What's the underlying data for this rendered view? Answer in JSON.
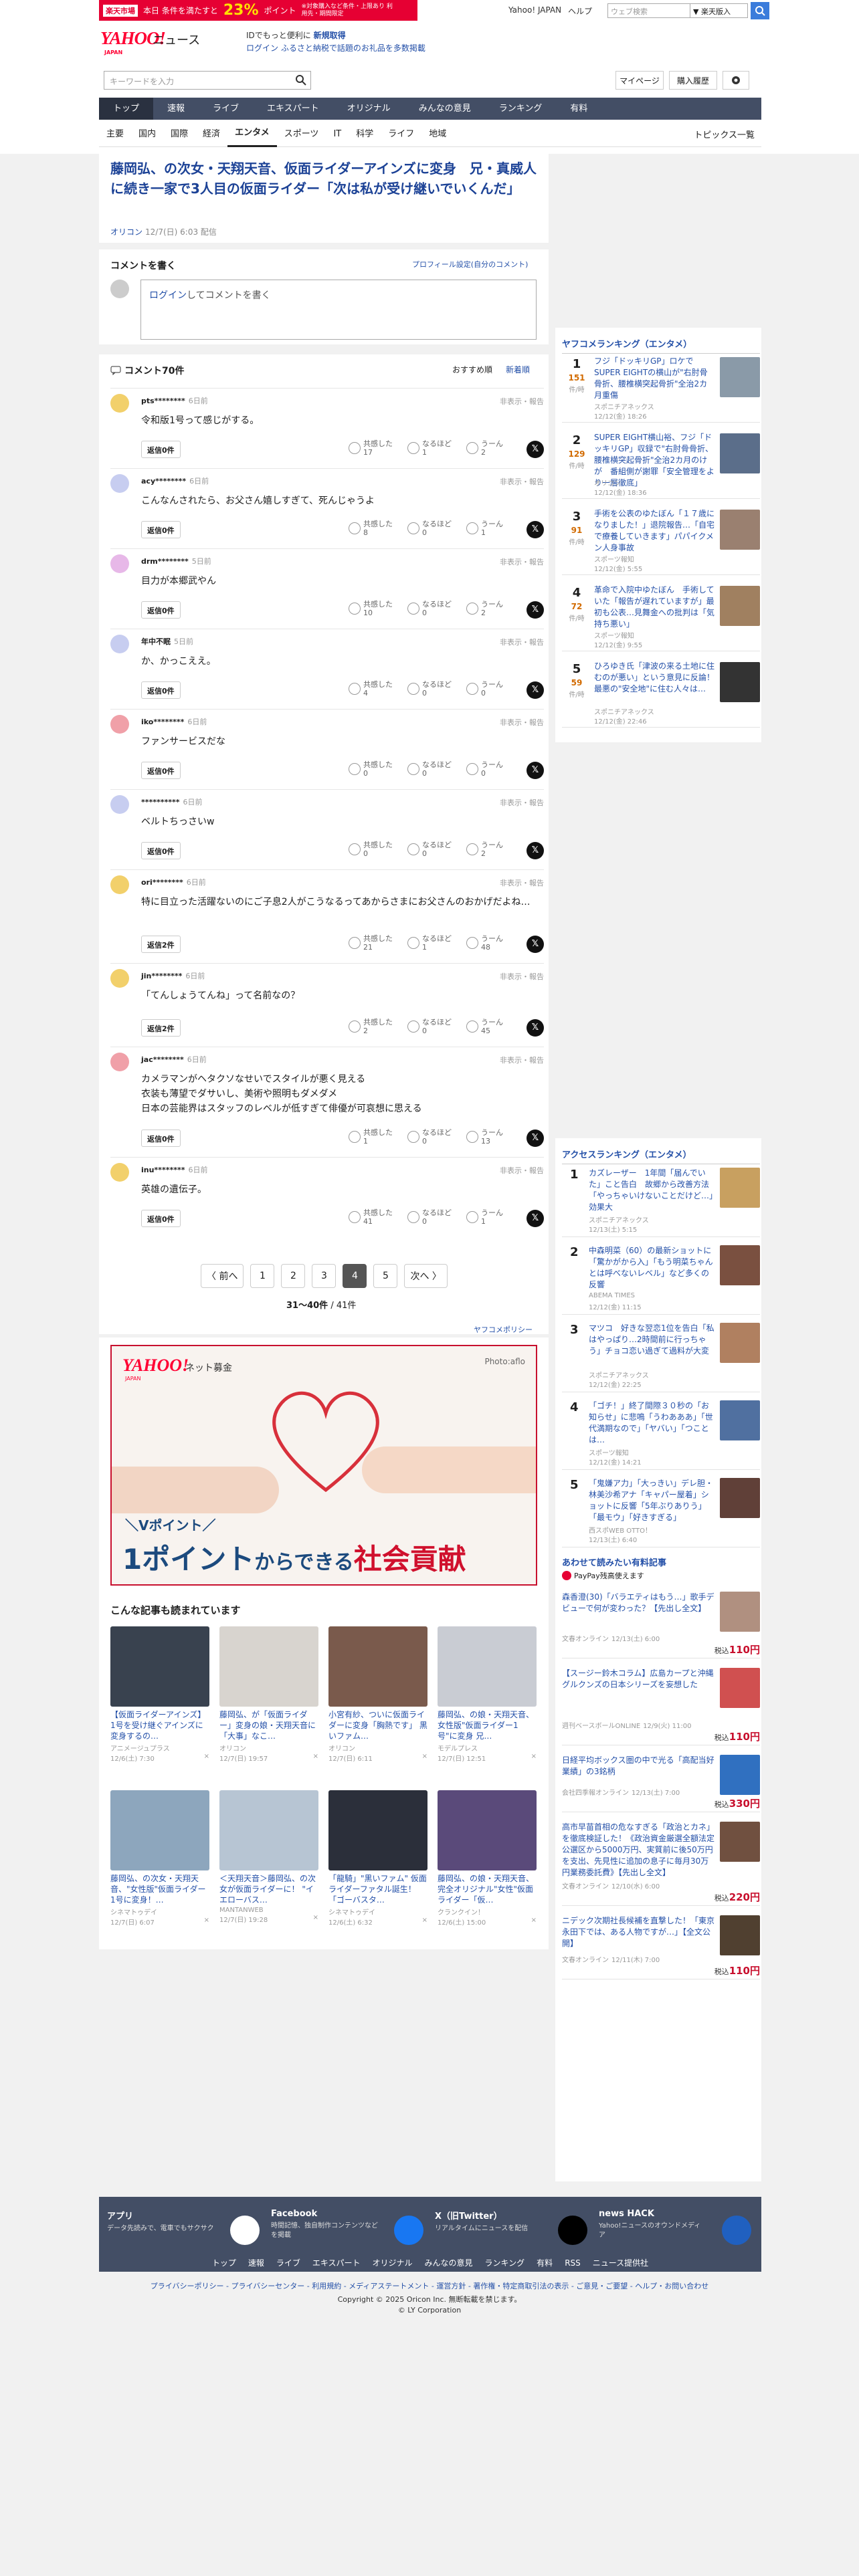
{
  "promo": {
    "brand": "楽天市場",
    "text": "本日 条件を満たすと",
    "pct": "23%",
    "suffix": "ポイント",
    "note": "※対象購入など条件・上限あり 利用先・期間限定"
  },
  "toplinks": [
    "Yahoo! JAPAN",
    "ヘルプ"
  ],
  "search_top": {
    "placeholder": "ウェブ検索",
    "button": "▼ 楽天版入"
  },
  "logo": {
    "main": "YAHOO!",
    "sub": "JAPAN",
    "word": "ニュース"
  },
  "header_promo": {
    "line1_pre": "IDでもっと便利に",
    "line1_link": "新規取得",
    "line2_link": "ログイン",
    "line2": "ふるさと納税で話題のお礼品を多数掲載"
  },
  "search": {
    "placeholder": "キーワードを入力",
    "mypage": "マイページ",
    "purchase": "購入履歴"
  },
  "nav": {
    "items": [
      "トップ",
      "速報",
      "ライブ",
      "エキスパート",
      "オリジナル",
      "みんなの意見",
      "ランキング",
      "有料"
    ],
    "active": 0
  },
  "subnav": {
    "items": [
      "主要",
      "国内",
      "国際",
      "経済",
      "エンタメ",
      "スポーツ",
      "IT",
      "科学",
      "ライフ",
      "地域"
    ],
    "active": 4,
    "right": "トピックス一覧"
  },
  "article": {
    "title": "藤岡弘、の次女・天翔天音、仮面ライダーアインズに変身　兄・真威人に続き一家で3人目の仮面ライダー「次は私が受け継いでいくんだ」",
    "source": "オリコン",
    "date": "12/7(日) 6:03 配信"
  },
  "comment_form": {
    "heading": "コメントを書く",
    "profile_link": "プロフィール設定(自分のコメント)",
    "login": "ログイン",
    "placeholder_rest": "してコメントを書く"
  },
  "comments_header": {
    "count": "コメント70件",
    "sort_recommend": "おすすめ順",
    "sort_new": "新着順"
  },
  "comment_labels": {
    "report": "非表示・報告",
    "agree": "共感した",
    "nice": "なるほど",
    "hmm": "うーん"
  },
  "comments": [
    {
      "name": "pts********",
      "time": "6日前",
      "text": "令和版1号って感じがする。",
      "reply": "返信0件",
      "agree": "17",
      "nice": "1",
      "hmm": "2",
      "avatar": "#f2d06b"
    },
    {
      "name": "acy********",
      "time": "6日前",
      "text": "こんなんされたら、お父さん嬉しすぎて、死んじゃうよ",
      "reply": "返信0件",
      "agree": "8",
      "nice": "0",
      "hmm": "1",
      "avatar": "#c7cdf0"
    },
    {
      "name": "drm********",
      "time": "5日前",
      "text": "目力が本郷武やん",
      "reply": "返信0件",
      "agree": "10",
      "nice": "0",
      "hmm": "2",
      "avatar": "#e7b8e8"
    },
    {
      "name": "年中不眠",
      "time": "5日前",
      "text": "か、かっこええ。",
      "reply": "返信0件",
      "agree": "4",
      "nice": "0",
      "hmm": "0",
      "avatar": "#c7cdf0"
    },
    {
      "name": "iko********",
      "time": "6日前",
      "text": "ファンサービスだな",
      "reply": "返信0件",
      "agree": "0",
      "nice": "0",
      "hmm": "0",
      "avatar": "#f0a0a8"
    },
    {
      "name": "**********",
      "time": "6日前",
      "text": "ベルトちっさいw",
      "reply": "返信0件",
      "agree": "0",
      "nice": "0",
      "hmm": "2",
      "avatar": "#c7cdf0"
    },
    {
      "name": "ori********",
      "time": "6日前",
      "text": "特に目立った活躍ないのにご子息2人がこうなるってあからさまにお父さんのおかげだよね…",
      "reply": "返信2件",
      "agree": "21",
      "nice": "1",
      "hmm": "48",
      "avatar": "#f2d06b"
    },
    {
      "name": "jin********",
      "time": "6日前",
      "text": "「てんしょうてんね」って名前なの？",
      "reply": "返信2件",
      "agree": "2",
      "nice": "0",
      "hmm": "45",
      "avatar": "#f2d06b"
    },
    {
      "name": "jac********",
      "time": "6日前",
      "text": "カメラマンがヘタクソなせいでスタイルが悪く見える\n衣装も薄望でダサいし、美術や照明もダメダメ\n日本の芸能界はスタッフのレベルが低すぎて俳優が可哀想に思える",
      "reply": "返信0件",
      "agree": "1",
      "nice": "0",
      "hmm": "13",
      "avatar": "#f0a0a8"
    },
    {
      "name": "inu********",
      "time": "6日前",
      "text": "英雄の遺伝子。",
      "reply": "返信0件",
      "agree": "41",
      "nice": "0",
      "hmm": "1",
      "avatar": "#f2d06b"
    }
  ],
  "pager": {
    "prev": "〈 前へ",
    "pages": [
      "1",
      "2",
      "3",
      "4",
      "5"
    ],
    "current": "4",
    "next": "次へ 〉",
    "range": "31〜40件",
    "total": " / 41件"
  },
  "policy": "ヤフコメポリシー",
  "banner": {
    "logo": "YAHOO!",
    "logo_sub": "JAPAN",
    "label": "ネット募金",
    "photo": "Photo:aflo",
    "vpoint": "＼Vポイント／",
    "copy1": "1ポイント",
    "copy2": "からできる",
    "copy3": "社会貢献"
  },
  "related": {
    "heading": "こんな記事も読まれています",
    "items": [
      {
        "title": "【仮面ライダーアインズ】1号を受け継ぐアインズに変身するの…",
        "source": "アニメージュプラス",
        "date": "12/6(土) 7:30",
        "color": "#39424f"
      },
      {
        "title": "藤岡弘、が「仮面ライダー」変身の娘・天翔天音に「大事」なこ…",
        "source": "オリコン",
        "date": "12/7(日) 19:57",
        "color": "#d8d4cf"
      },
      {
        "title": "小宮有紗、ついに仮面ライダーに変身「胸熱です」 黒いファム…",
        "source": "オリコン",
        "date": "12/7(日) 6:11",
        "color": "#7a5a4c"
      },
      {
        "title": "藤岡弘、の娘・天翔天音、女性版\"仮面ライダー1号\"に変身 兄…",
        "source": "モデルプレス",
        "date": "12/7(日) 12:51",
        "color": "#c9ccd3"
      },
      {
        "title": "藤岡弘、の次女・天翔天音、\"女性版\"仮面ライダー1号に変身！…",
        "source": "シネマトゥデイ",
        "date": "12/7(日) 6:07",
        "color": "#8da6bd"
      },
      {
        "title": "＜天翔天音＞藤岡弘、の次女が仮面ライダーに！ \"イエローバス…",
        "source": "MANTANWEB",
        "date": "12/7(日) 19:28",
        "color": "#b7c5d3"
      },
      {
        "title": "「龍騎」\"黒いファム\" 仮面ライダーファタル誕生！「ゴーバスタ…",
        "source": "シネマトゥデイ",
        "date": "12/6(土) 6:32",
        "color": "#2b2f3a"
      },
      {
        "title": "藤岡弘、の娘・天翔天音、完全オリジナル\"女性\"仮面ライダー「仮…",
        "source": "クランクイン！",
        "date": "12/6(土) 15:00",
        "color": "#5a4a7a"
      }
    ]
  },
  "ranking_ent": {
    "heading": "ヤフコメランキング（エンタメ）",
    "count_label": "件/時",
    "items": [
      {
        "n": "1",
        "count": "151",
        "title": "フジ「ドッキリGP」ロケでSUPER EIGHTの横山が\"右肘骨骨折、腰椎横突起骨折\"全治2カ月重傷",
        "src": "スポニチアネックス",
        "date": "12/12(金) 18:26",
        "color": "#8a9aa8"
      },
      {
        "n": "2",
        "count": "129",
        "title": "SUPER EIGHT横山裕、フジ「ドッキリGP」収録で\"右肘骨骨折、腰椎横突起骨折\"全治2カ月のけが　番組側が謝罪「安全管理をより一層徹底」",
        "src": "オリコン",
        "date": "12/12(金) 18:36",
        "color": "#5b6e8a"
      },
      {
        "n": "3",
        "count": "91",
        "title": "手術を公表のゆたぼん「１７歳になりました！」退院報告…「自宅で療養していきます」パパイクメン人身事故",
        "src": "スポーツ報知",
        "date": "12/12(金) 5:55",
        "color": "#9a8070"
      },
      {
        "n": "4",
        "count": "72",
        "title": "革命で入院中ゆたぼん　手術していた「報告が遅れていますが」最初も公表…見舞金への批判は「気持ち悪い」",
        "src": "スポーツ報知",
        "date": "12/12(金) 9:55",
        "color": "#a08060"
      },
      {
        "n": "5",
        "count": "59",
        "title": "ひろゆき氏「津波の来る土地に住むのが悪い」という意見に反論！最悪の\"安全地\"に住む人々は…",
        "src": "スポニチアネックス",
        "date": "12/12(金) 22:46",
        "color": "#333"
      }
    ]
  },
  "ranking_access": {
    "heading": "アクセスランキング（エンタメ）",
    "items": [
      {
        "n": "1",
        "title": "カズレーザー　1年間「届んでいた」こと告白　故郷から改善方法「やっちゃいけないことだけど…」効果大",
        "src": "スポニチアネックス",
        "date": "12/13(土) 5:15",
        "color": "#c8a060"
      },
      {
        "n": "2",
        "title": "中森明菜（60）の最新ショットに「驚かがから入」「もう明菜ちゃんとは呼べないレベル」など多くの反響",
        "src": "ABEMA TIMES",
        "date": "12/12(金) 11:15",
        "color": "#7a5040"
      },
      {
        "n": "3",
        "title": "マツコ　好きな翌恋1位を告白「私はやっぱり…2時間前に行っちゃう」チョコ恋い過ぎて過料が大変",
        "src": "スポニチアネックス",
        "date": "12/12(金) 22:25",
        "color": "#b08060"
      },
      {
        "n": "4",
        "title": "「ゴチ！」終了間際３０秒の「お知らせ」に悲鳴「うわあああ」「世代満期なので」「ヤバい」「つことは…",
        "src": "スポーツ報知",
        "date": "12/12(金) 14:21",
        "color": "#5070a0"
      },
      {
        "n": "5",
        "title": "「鬼嫌ア力」「大っきい」デレ胆・林美沙希アナ「キャパー屋着」ショットに反響「5年ぶりありう」「最モウ」「好きすぎる」",
        "src": "西スポWEB OTTO！",
        "date": "12/13(土) 6:40",
        "color": "#604038"
      }
    ]
  },
  "paid": {
    "heading": "あわせて読みたい有料記事",
    "sub": "PayPay残高使えます",
    "price_label": "税込",
    "items": [
      {
        "title": "森香澄(30)「バラエティはもう…」歌手デビューで何が変わった？【先出し全文】",
        "src": "文春オンライン",
        "date": "12/13(土) 6:00",
        "price": "110円",
        "color": "#b09080"
      },
      {
        "title": "【スージー鈴木コラム】広島カープと沖縄グルクンズの日本シリーズを妄想した",
        "src": "週刊ベースボールONLINE",
        "date": "12/9(火) 11:00",
        "price": "110円",
        "color": "#d05050"
      },
      {
        "title": "日経平均ボックス圏の中で光る「高配当好業績」の3銘柄",
        "src": "会社四季報オンライン",
        "date": "12/13(土) 7:00",
        "price": "330円",
        "color": "#3070c0"
      },
      {
        "title": "高市早苗首相の危なすぎる「政治とカネ」を徹底検証した！《政治資金厳選全額法定公選区から5000万円、実質前に後50万円を支出、先見性に追加の息子に毎月30万円業務委託費》【先出し全文】",
        "src": "文春オンライン",
        "date": "12/10(水) 6:00",
        "price": "220円",
        "color": "#705040"
      },
      {
        "title": "ニデック次期社長候補を直撃した！「東京永田下では、ある人物ですが…」【全文公開】",
        "src": "文春オンライン",
        "date": "12/11(木) 7:00",
        "price": "110円",
        "color": "#504030"
      }
    ]
  },
  "footer": {
    "blocks": [
      {
        "h": "アプリ",
        "d": "データ先読みで、電車でもサクサク",
        "color": "#fff"
      },
      {
        "h": "Facebook",
        "d": "時間記憶、独自制作コンテンツなどを掲載",
        "color": "#1877f2"
      },
      {
        "h": "X（旧Twitter）",
        "d": "リアルタイムにニュースを配信",
        "color": "#000"
      },
      {
        "h": "news HACK",
        "d": "Yahoo!ニュースのオウンドメディア",
        "color": "#2060c0"
      }
    ],
    "nav": [
      "トップ",
      "速報",
      "ライブ",
      "エキスパート",
      "オリジナル",
      "みんなの意見",
      "ランキング",
      "有料",
      "RSS",
      "ニュース提供社"
    ],
    "links": "プライバシーポリシー - プライバシーセンター - 利用規約 - メディアステートメント - 運営方針 - 著作権・特定商取引法の表示 - ご意見・ご要望 - ヘルプ・お問い合わせ",
    "copy1": "Copyright © 2025 Oricon Inc. 無断転載を禁じます。",
    "copy2": "© LY Corporation"
  }
}
